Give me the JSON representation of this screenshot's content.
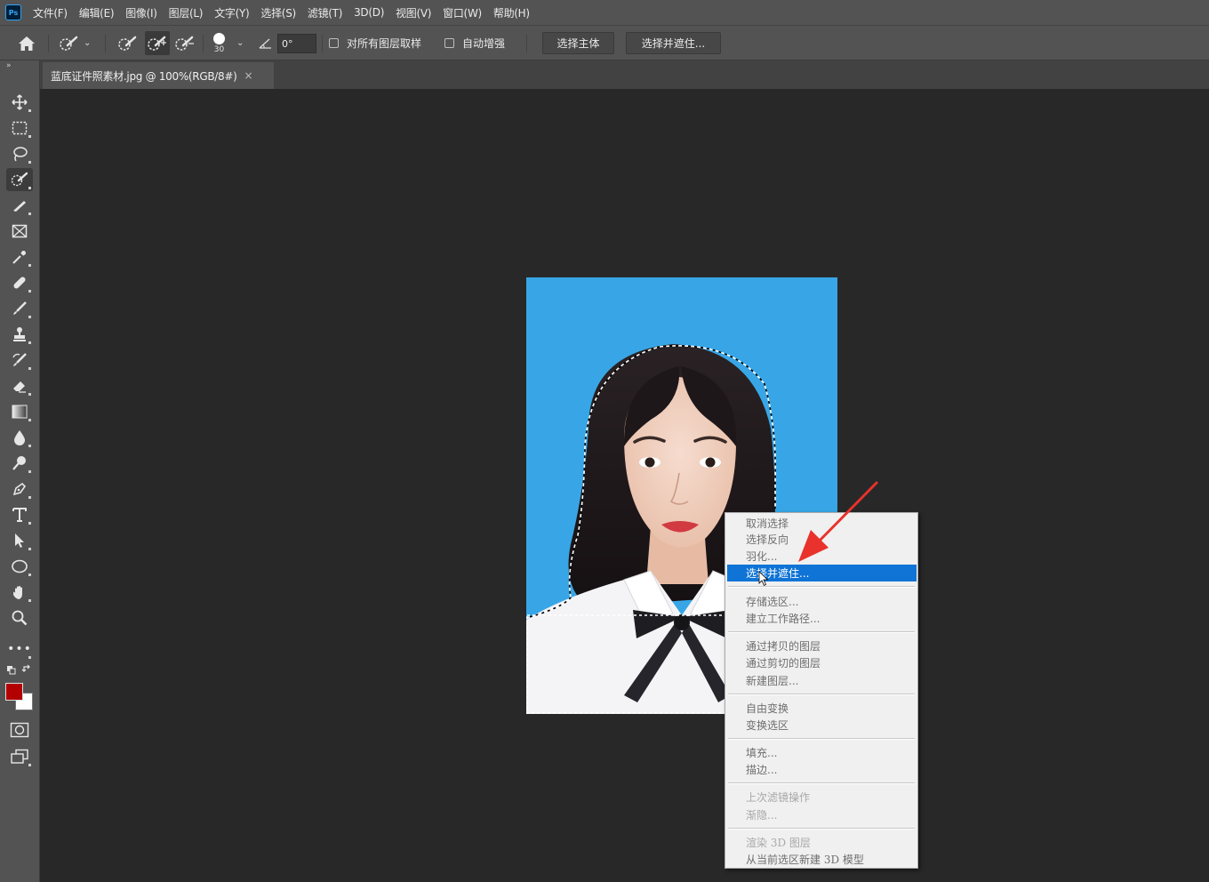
{
  "menubar": {
    "logo": "Ps",
    "items": [
      "文件(F)",
      "编辑(E)",
      "图像(I)",
      "图层(L)",
      "文字(Y)",
      "选择(S)",
      "滤镜(T)",
      "3D(D)",
      "视图(V)",
      "窗口(W)",
      "帮助(H)"
    ]
  },
  "options": {
    "brush_size": "30",
    "angle_value": "0°",
    "sample_all_label": "对所有图层取样",
    "auto_enhance_label": "自动增强",
    "select_subject_label": "选择主体",
    "select_mask_label": "选择并遮住..."
  },
  "document": {
    "tab_title": "蓝底证件照素材.jpg @ 100%(RGB/8#)",
    "close_glyph": "×"
  },
  "toolbar": {
    "collapse_glyph": "»",
    "tools": [
      "move-tool",
      "marquee-tool",
      "lasso-tool",
      "quick-selection-tool",
      "pen-selection-tool",
      "frame-tool",
      "eyedropper-tool",
      "healing-brush-tool",
      "brush-tool",
      "clone-stamp-tool",
      "history-brush-tool",
      "eraser-tool",
      "gradient-tool",
      "blur-tool",
      "dodge-tool",
      "pen-tool",
      "type-tool",
      "path-selection-tool",
      "ellipse-tool",
      "hand-tool",
      "zoom-tool",
      "more-tools",
      "swap-colors",
      "color-swatches",
      "quick-mask",
      "screen-mode"
    ],
    "foreground_color": "#b30000",
    "background_color": "#ffffff"
  },
  "context_menu": {
    "items": [
      {
        "label": "取消选择",
        "state": "normal"
      },
      {
        "label": "选择反向",
        "state": "normal"
      },
      {
        "label": "羽化...",
        "state": "normal"
      },
      {
        "label": "选择并遮住...",
        "state": "highlighted"
      },
      {
        "label": "存储选区...",
        "state": "normal"
      },
      {
        "label": "建立工作路径...",
        "state": "normal"
      },
      {
        "label": "通过拷贝的图层",
        "state": "normal"
      },
      {
        "label": "通过剪切的图层",
        "state": "normal"
      },
      {
        "label": "新建图层...",
        "state": "normal"
      },
      {
        "label": "自由变换",
        "state": "normal"
      },
      {
        "label": "变换选区",
        "state": "normal"
      },
      {
        "label": "填充...",
        "state": "normal"
      },
      {
        "label": "描边...",
        "state": "normal"
      },
      {
        "label": "上次滤镜操作",
        "state": "disabled"
      },
      {
        "label": "渐隐...",
        "state": "disabled"
      },
      {
        "label": "渲染 3D 图层",
        "state": "disabled"
      },
      {
        "label": "从当前选区新建 3D 模型",
        "state": "normal"
      }
    ]
  },
  "colors": {
    "photo_background": "#38a6e6",
    "menu_highlight": "#0f74d6",
    "annotation_arrow": "#e8322b"
  }
}
